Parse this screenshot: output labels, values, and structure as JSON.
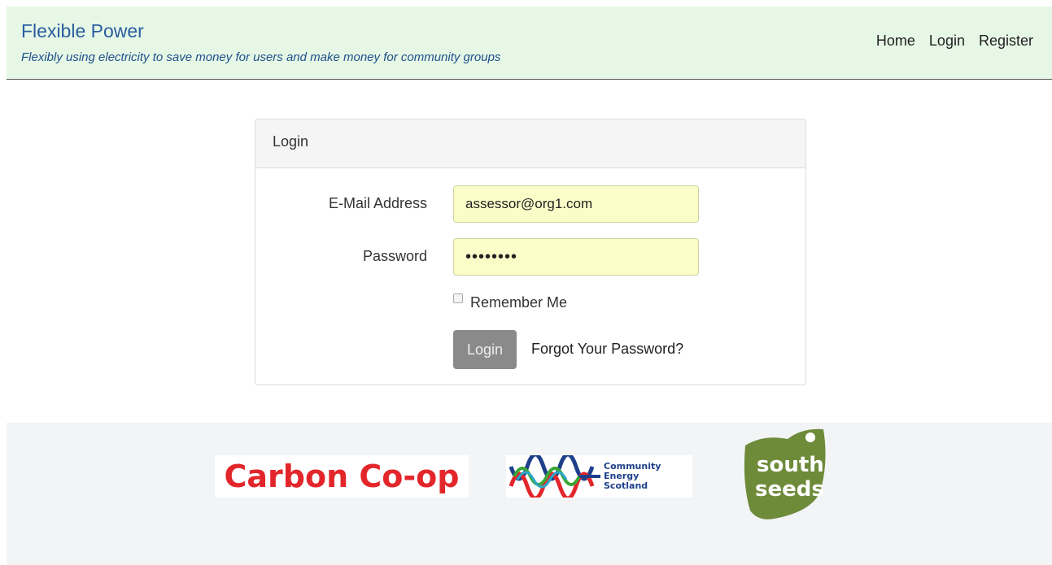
{
  "header": {
    "title": "Flexible Power",
    "tagline": "Flexibly using electricity to save money for users and make money for community groups",
    "nav": [
      "Home",
      "Login",
      "Register"
    ]
  },
  "login_panel": {
    "heading": "Login",
    "email_label": "E-Mail Address",
    "email_value": "assessor@org1.com",
    "password_label": "Password",
    "password_value": "••••••••",
    "remember_label": "Remember Me",
    "remember_checked": false,
    "submit_label": "Login",
    "forgot_link": "Forgot Your Password?"
  },
  "footer": {
    "logos": [
      {
        "name": "Carbon Co-op",
        "text": "Carbon Co-op",
        "color": "#e3262b"
      },
      {
        "name": "Community Energy Scotland",
        "text_lines": [
          "Community",
          "Energy",
          "Scotland"
        ],
        "color": "#1e3f8a"
      },
      {
        "name": "South Seeds",
        "text_lines": [
          "south",
          "seeds"
        ],
        "color": "#6e8b3a"
      }
    ]
  },
  "colors": {
    "navbar_bg": "#e6f7e6",
    "brand": "#2a5d9f",
    "input_bg": "#fafdc8",
    "button_bg": "#8a8a8a",
    "footer_bg": "#f3f4f6"
  }
}
